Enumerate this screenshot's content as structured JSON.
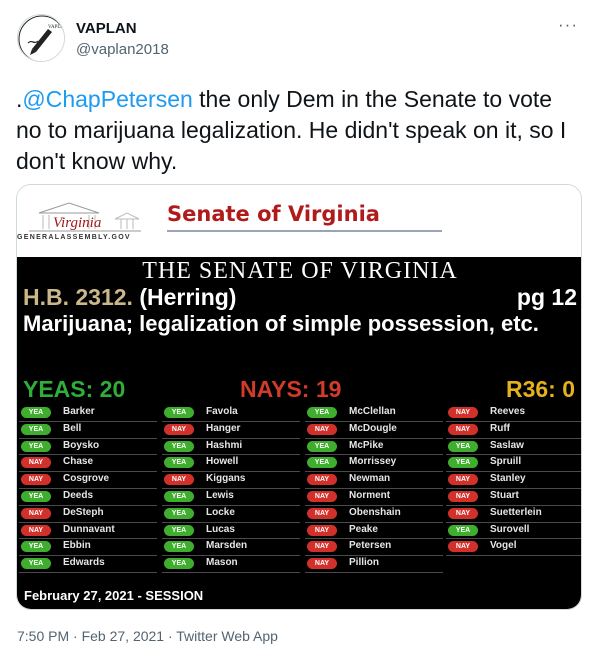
{
  "author": {
    "display_name": "VAPLAN",
    "handle": "@vaplan2018",
    "avatar_text": "VAPLAN"
  },
  "tweet": {
    "text_before": ".",
    "mention": "@ChapPetersen",
    "text_after": " the only Dem in the Senate to vote no to marijuana legalization. He didn't speak on it, so I don't know why.",
    "more": "···"
  },
  "image": {
    "header": {
      "logo_text": "Virginia",
      "ga_text": "GENERALASSEMBLY.GOV",
      "title": "Senate of Virginia"
    },
    "board": {
      "title": "THE SENATE OF VIRGINIA",
      "bill_number": "H.B. 2312.",
      "sponsor": "(Herring)",
      "page": "pg 12",
      "description": "Marijuana; legalization of simple possession, etc.",
      "yeas": "YEAS: 20",
      "nays": "NAYS: 19",
      "r36": "R36: 0"
    },
    "votes": {
      "col1": [
        {
          "name": "Barker",
          "vote": "YEA"
        },
        {
          "name": "Bell",
          "vote": "YEA"
        },
        {
          "name": "Boysko",
          "vote": "YEA"
        },
        {
          "name": "Chase",
          "vote": "NAY"
        },
        {
          "name": "Cosgrove",
          "vote": "NAY"
        },
        {
          "name": "Deeds",
          "vote": "YEA"
        },
        {
          "name": "DeSteph",
          "vote": "NAY"
        },
        {
          "name": "Dunnavant",
          "vote": "NAY"
        },
        {
          "name": "Ebbin",
          "vote": "YEA"
        },
        {
          "name": "Edwards",
          "vote": "YEA"
        }
      ],
      "col2": [
        {
          "name": "Favola",
          "vote": "YEA"
        },
        {
          "name": "Hanger",
          "vote": "NAY"
        },
        {
          "name": "Hashmi",
          "vote": "YEA"
        },
        {
          "name": "Howell",
          "vote": "YEA"
        },
        {
          "name": "Kiggans",
          "vote": "NAY"
        },
        {
          "name": "Lewis",
          "vote": "YEA"
        },
        {
          "name": "Locke",
          "vote": "YEA"
        },
        {
          "name": "Lucas",
          "vote": "YEA"
        },
        {
          "name": "Marsden",
          "vote": "YEA"
        },
        {
          "name": "Mason",
          "vote": "YEA"
        }
      ],
      "col3": [
        {
          "name": "McClellan",
          "vote": "YEA"
        },
        {
          "name": "McDougle",
          "vote": "NAY"
        },
        {
          "name": "McPike",
          "vote": "YEA"
        },
        {
          "name": "Morrissey",
          "vote": "YEA"
        },
        {
          "name": "Newman",
          "vote": "NAY"
        },
        {
          "name": "Norment",
          "vote": "NAY"
        },
        {
          "name": "Obenshain",
          "vote": "NAY"
        },
        {
          "name": "Peake",
          "vote": "NAY"
        },
        {
          "name": "Petersen",
          "vote": "NAY"
        },
        {
          "name": "Pillion",
          "vote": "NAY"
        }
      ],
      "col4": [
        {
          "name": "Reeves",
          "vote": "NAY"
        },
        {
          "name": "Ruff",
          "vote": "NAY"
        },
        {
          "name": "Saslaw",
          "vote": "YEA"
        },
        {
          "name": "Spruill",
          "vote": "YEA"
        },
        {
          "name": "Stanley",
          "vote": "NAY"
        },
        {
          "name": "Stuart",
          "vote": "NAY"
        },
        {
          "name": "Suetterlein",
          "vote": "NAY"
        },
        {
          "name": "Surovell",
          "vote": "YEA"
        },
        {
          "name": "Vogel",
          "vote": "NAY"
        }
      ]
    },
    "session": "February 27, 2021 - SESSION"
  },
  "footer": {
    "meta": "7:50 PM · Feb 27, 2021 · Twitter Web App"
  },
  "colors": {
    "link": "#1d9bf0",
    "yea": "#3fae2e",
    "nay": "#d1312a",
    "yeas_tally": "#2fae3a",
    "nays_tally": "#d23a2a",
    "r36_tally": "#e4b21c"
  }
}
